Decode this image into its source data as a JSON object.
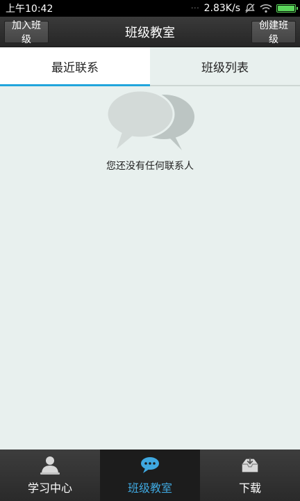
{
  "status_bar": {
    "time": "上午10:42",
    "dots": "···",
    "speed": "2.83K/s",
    "battery_level": 1.0,
    "colors": {
      "battery": "#5cd65c"
    }
  },
  "header": {
    "title": "班级教室",
    "left_button": "加入班级",
    "right_button": "创建班级"
  },
  "tabs": [
    {
      "label": "最近联系",
      "active": true
    },
    {
      "label": "班级列表",
      "active": false
    }
  ],
  "content": {
    "empty_icon": "chat-bubbles-icon",
    "empty_text": "您还没有任何联系人"
  },
  "bottom_nav": [
    {
      "label": "学习中心",
      "icon": "person-icon",
      "active": false
    },
    {
      "label": "班级教室",
      "icon": "chat-icon",
      "active": true
    },
    {
      "label": "下载",
      "icon": "download-tray-icon",
      "active": false
    }
  ],
  "colors": {
    "accent": "#21a5dc",
    "active_nav_text": "#3fa8e0",
    "background": "#e8f0ee"
  }
}
